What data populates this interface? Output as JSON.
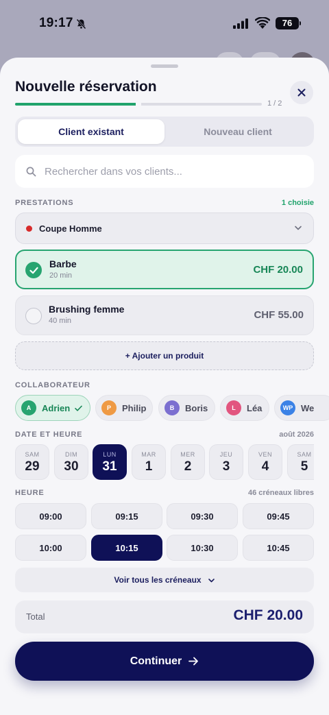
{
  "status_bar": {
    "time": "19:17",
    "battery": "76"
  },
  "sheet": {
    "title": "Nouvelle réservation",
    "step": "1 / 2",
    "progress": 0.5
  },
  "tabs": {
    "existing": "Client existant",
    "new": "Nouveau client"
  },
  "search": {
    "placeholder": "Rechercher dans vos clients..."
  },
  "services": {
    "label": "PRESTATIONS",
    "count": "1 choisie",
    "count_color": "#21a36c",
    "category": "Coupe Homme",
    "items": [
      {
        "name": "Barbe",
        "duration": "20 min",
        "price": "CHF 20.00",
        "selected": true
      },
      {
        "name": "Brushing femme",
        "duration": "40 min",
        "price": "CHF 55.00",
        "selected": false
      }
    ],
    "add_product": "+ Ajouter un produit"
  },
  "staff": {
    "label": "COLLABORATEUR",
    "items": [
      {
        "initials": "A",
        "name": "Adrien",
        "color": "#27a470",
        "selected": true
      },
      {
        "initials": "P",
        "name": "Philip",
        "color": "#ef9a44",
        "selected": false
      },
      {
        "initials": "B",
        "name": "Boris",
        "color": "#7b6fd0",
        "selected": false
      },
      {
        "initials": "L",
        "name": "Léa",
        "color": "#e2557f",
        "selected": false
      },
      {
        "initials": "WP",
        "name": "We",
        "color": "#3b82e6",
        "selected": false
      }
    ]
  },
  "date": {
    "label": "DATE ET HEURE",
    "month": "août 2026",
    "days": [
      {
        "weekday": "SAM",
        "day": "29"
      },
      {
        "weekday": "DIM",
        "day": "30"
      },
      {
        "weekday": "LUN",
        "day": "31",
        "selected": true
      },
      {
        "weekday": "MAR",
        "day": "1"
      },
      {
        "weekday": "MER",
        "day": "2"
      },
      {
        "weekday": "JEU",
        "day": "3"
      },
      {
        "weekday": "VEN",
        "day": "4"
      },
      {
        "weekday": "SAM",
        "day": "5"
      }
    ]
  },
  "time": {
    "label": "HEURE",
    "free": "46 créneaux libres",
    "slots": [
      "09:00",
      "09:15",
      "09:30",
      "09:45",
      "10:00",
      "10:15",
      "10:30",
      "10:45"
    ],
    "selected": "10:15",
    "see_all": "Voir tous les créneaux"
  },
  "total": {
    "label": "Total",
    "value": "CHF 20.00"
  },
  "cta": {
    "label": "Continuer"
  }
}
